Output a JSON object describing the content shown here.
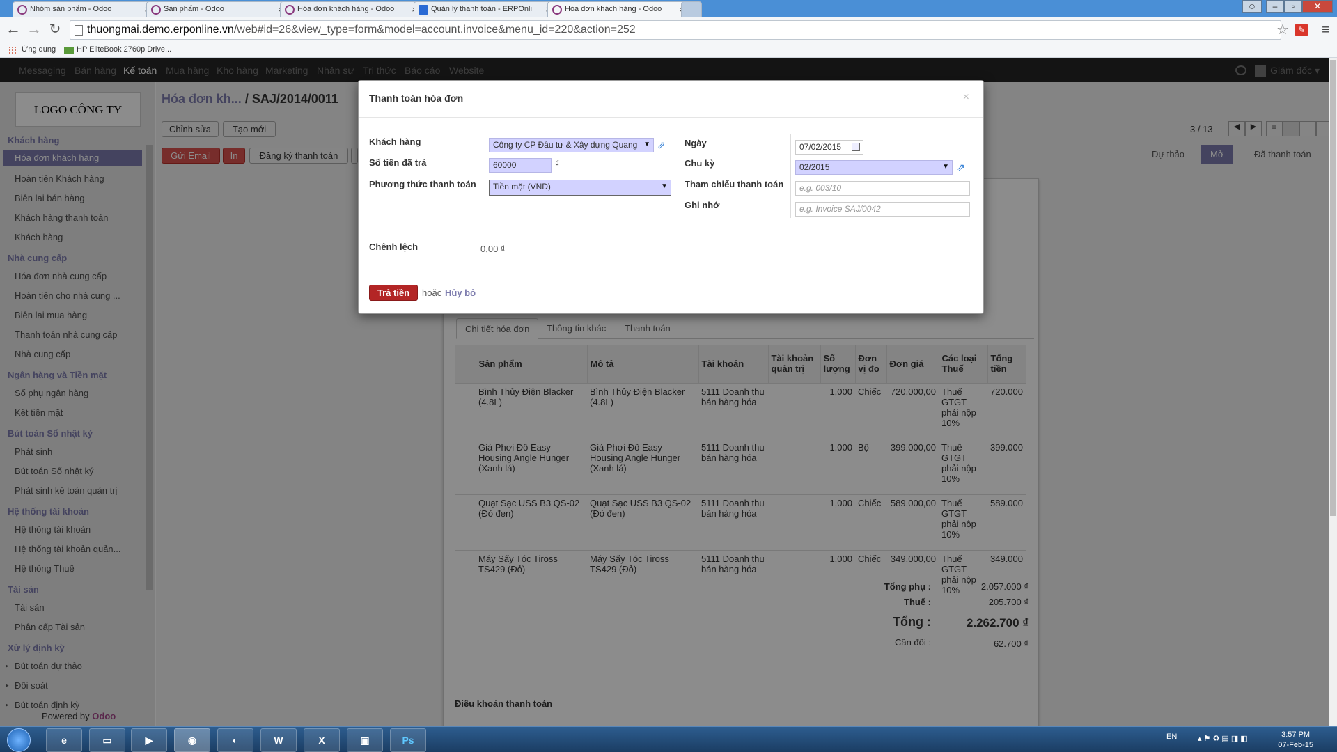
{
  "browser": {
    "tabs": [
      {
        "title": "Nhóm sản phẩm - Odoo",
        "icon": "odoo-icon"
      },
      {
        "title": "Sản phẩm - Odoo",
        "icon": "odoo-icon"
      },
      {
        "title": "Hóa đơn khách hàng - Odoo",
        "icon": "odoo-icon"
      },
      {
        "title": "Quản lý thanh toán - ERPOnli",
        "icon": "erp-icon"
      },
      {
        "title": "Hóa đơn khách hàng - Odoo",
        "icon": "odoo-icon",
        "active": true
      }
    ],
    "url_host": "thuongmai.demo.erponline.vn",
    "url_path": "/web#id=26&view_type=form&model=account.invoice&menu_id=220&action=252",
    "bookmarks": [
      "Ứng dụng",
      "HP EliteBook 2760p Drive..."
    ]
  },
  "topmenu": {
    "items": [
      "Messaging",
      "Bán hàng",
      "Kế toán",
      "Mua hàng",
      "Kho hàng",
      "Marketing",
      "Nhân sự",
      "Tri thức",
      "Báo cáo",
      "Website"
    ],
    "active": "Kế toán",
    "user": "Giám đốc"
  },
  "sidebar": {
    "logo": "LOGO CÔNG TY",
    "sections": [
      {
        "title": "Khách hàng",
        "items": [
          "Hóa đơn khách hàng",
          "Hoàn tiền Khách hàng",
          "Biên lai bán hàng",
          "Khách hàng thanh toán",
          "Khách hàng"
        ]
      },
      {
        "title": "Nhà cung cấp",
        "items": [
          "Hóa đơn nhà cung cấp",
          "Hoàn tiền cho nhà cung ...",
          "Biên lai mua hàng",
          "Thanh toán nhà cung cấp",
          "Nhà cung cấp"
        ]
      },
      {
        "title": "Ngân hàng và Tiền mặt",
        "items": [
          "Sổ phụ ngân hàng",
          "Kết tiền mặt"
        ]
      },
      {
        "title": "Bút toán Sổ nhật ký",
        "items": [
          "Phát sinh",
          "Bút toán Sổ nhật ký",
          "Phát sinh kế toán quản trị"
        ]
      },
      {
        "title": "Hệ thống tài khoản",
        "items": [
          "Hệ thống tài khoản",
          "Hệ thống tài khoản quản...",
          "Hệ thống Thuế"
        ]
      },
      {
        "title": "Tài sản",
        "items": [
          "Tài sản",
          "Phân cấp Tài sản"
        ]
      },
      {
        "title": "Xử lý định kỳ",
        "items": [
          "Bút toán dự thảo",
          "Đối soát",
          "Bút toán định kỳ"
        ]
      }
    ],
    "powered_by": "Powered by",
    "powered_brand": "Odoo"
  },
  "main": {
    "breadcrumb_parent": "Hóa đơn kh...",
    "breadcrumb_current": "/ SAJ/2014/0011",
    "buttons": {
      "edit": "Chỉnh sửa",
      "create": "Tạo mới",
      "send_email": "Gửi Email",
      "print": "In",
      "register_payment": "Đăng ký thanh toán"
    },
    "pager": "3 / 13",
    "status": {
      "draft": "Dự thảo",
      "open": "Mở",
      "paid": "Đã thanh toán"
    },
    "tabs": [
      "Chi tiết hóa đơn",
      "Thông tin khác",
      "Thanh toán"
    ],
    "columns": [
      "Sản phẩm",
      "Mô tả",
      "Tài khoản",
      "Tài khoản quản trị",
      "Số lượng",
      "Đơn vị đo",
      "Đơn giá",
      "Các loại Thuế",
      "Tổng tiền"
    ],
    "rows": [
      {
        "product": "Bình Thủy Điện Blacker (4.8L)",
        "desc": "Bình Thủy Điện Blacker (4.8L)",
        "account": "5111 Doanh thu bán hàng hóa",
        "analytic": "",
        "qty": "1,000",
        "uom": "Chiếc",
        "price": "720.000,00",
        "tax": "Thuế GTGT phải nộp 10%",
        "total": "720.000"
      },
      {
        "product": "Giá Phơi Đồ Easy Housing Angle Hunger (Xanh lá)",
        "desc": "Giá Phơi Đồ Easy Housing Angle Hunger (Xanh lá)",
        "account": "5111 Doanh thu bán hàng hóa",
        "analytic": "",
        "qty": "1,000",
        "uom": "Bộ",
        "price": "399.000,00",
        "tax": "Thuế GTGT phải nộp 10%",
        "total": "399.000"
      },
      {
        "product": "Quạt Sạc USS B3 QS-02 (Đỏ đen)",
        "desc": "Quạt Sạc USS B3 QS-02 (Đỏ đen)",
        "account": "5111 Doanh thu bán hàng hóa",
        "analytic": "",
        "qty": "1,000",
        "uom": "Chiếc",
        "price": "589.000,00",
        "tax": "Thuế GTGT phải nộp 10%",
        "total": "589.000"
      },
      {
        "product": "Máy Sấy Tóc Tiross TS429 (Đỏ)",
        "desc": "Máy Sấy Tóc Tiross TS429 (Đỏ)",
        "account": "5111 Doanh thu bán hàng hóa",
        "analytic": "",
        "qty": "1,000",
        "uom": "Chiếc",
        "price": "349.000,00",
        "tax": "Thuế GTGT phải nộp 10%",
        "total": "349.000"
      }
    ],
    "totals": {
      "subtotal_label": "Tổng phụ :",
      "subtotal": "2.057.000 ₫",
      "tax_label": "Thuế :",
      "tax": "205.700 ₫",
      "total_label": "Tổng :",
      "total": "2.262.700 ₫",
      "balance_label": "Cân đối :",
      "balance": "62.700 ₫"
    },
    "payment_terms": "Điều khoản thanh toán"
  },
  "modal": {
    "title": "Thanh toán hóa đơn",
    "close": "×",
    "customer_label": "Khách hàng",
    "customer_value": "Công ty CP Đầu tư & Xây dựng Quang",
    "amount_label": "Số tiền đã trả",
    "amount_value": "60000",
    "currency": "₫",
    "method_label": "Phương thức thanh toán",
    "method_value": "Tiền mặt (VND)",
    "date_label": "Ngày",
    "date_value": "07/02/2015",
    "period_label": "Chu kỳ",
    "period_value": "02/2015",
    "ref_label": "Tham chiếu thanh toán",
    "ref_placeholder": "e.g. 003/10",
    "memo_label": "Ghi nhớ",
    "memo_placeholder": "e.g. Invoice SAJ/0042",
    "diff_label": "Chênh lệch",
    "diff_value": "0,00 ₫",
    "pay_button": "Trả tiền",
    "or_text": "hoặc",
    "cancel": "Hủy bỏ"
  },
  "taskbar": {
    "apps": [
      "Ps"
    ],
    "lang": "EN",
    "time": "3:57 PM",
    "date": "07-Feb-15"
  }
}
